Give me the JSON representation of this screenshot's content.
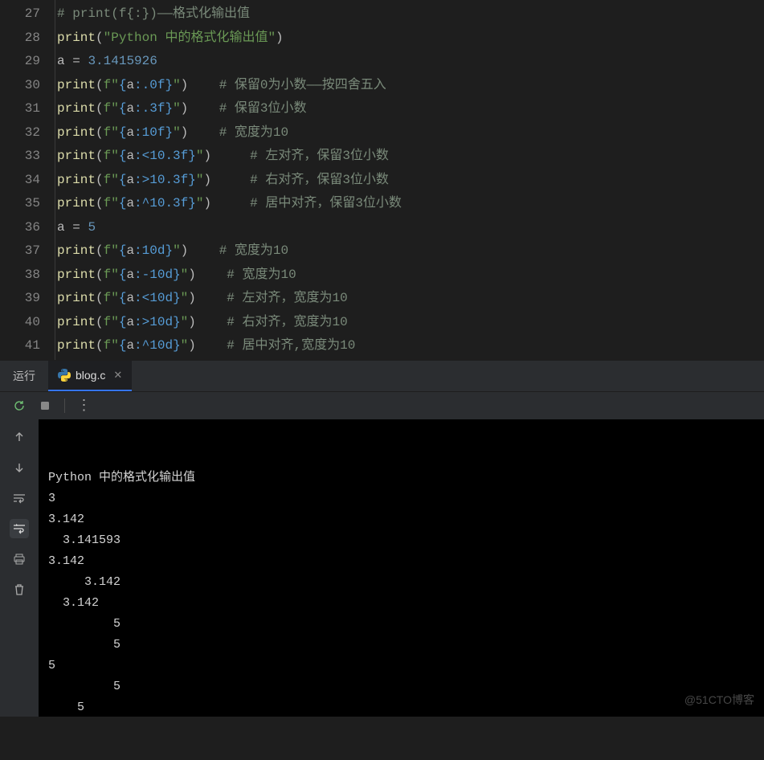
{
  "editor": {
    "startLine": 27,
    "lines": [
      {
        "n": 27,
        "type": "comment",
        "text": "# print(f{:})——格式化输出值"
      },
      {
        "n": 28,
        "type": "print_str",
        "str": "\"Python 中的格式化输出值\""
      },
      {
        "n": 29,
        "type": "assign",
        "var": "a",
        "val": "3.1415926"
      },
      {
        "n": 30,
        "type": "print_fmt",
        "pre": "f\"",
        "open": "{",
        "var": "a",
        "fmt": ":.0f",
        "close": "}",
        "post": "\"",
        "comment_gap": "    ",
        "comment": "# 保留0为小数——按四舍五入"
      },
      {
        "n": 31,
        "type": "print_fmt",
        "pre": "f\"",
        "open": "{",
        "var": "a",
        "fmt": ":.3f",
        "close": "}",
        "post": "\"",
        "comment_gap": "    ",
        "comment": "# 保留3位小数"
      },
      {
        "n": 32,
        "type": "print_fmt",
        "pre": "f\"",
        "open": "{",
        "var": "a",
        "fmt": ":10f",
        "close": "}",
        "post": "\"",
        "comment_gap": "    ",
        "comment": "# 宽度为10"
      },
      {
        "n": 33,
        "type": "print_fmt",
        "pre": "f\"",
        "open": "{",
        "var": "a",
        "fmt": ":<10.3f",
        "close": "}",
        "post": "\"",
        "comment_gap": "     ",
        "comment": "# 左对齐，保留3位小数"
      },
      {
        "n": 34,
        "type": "print_fmt",
        "pre": "f\"",
        "open": "{",
        "var": "a",
        "fmt": ":>10.3f",
        "close": "}",
        "post": "\"",
        "comment_gap": "     ",
        "comment": "# 右对齐，保留3位小数"
      },
      {
        "n": 35,
        "type": "print_fmt",
        "pre": "f\"",
        "open": "{",
        "var": "a",
        "fmt": ":^10.3f",
        "close": "}",
        "post": "\"",
        "comment_gap": "     ",
        "comment": "# 居中对齐，保留3位小数"
      },
      {
        "n": 36,
        "type": "assign",
        "var": "a",
        "val": "5"
      },
      {
        "n": 37,
        "type": "print_fmt",
        "pre": "f\"",
        "open": "{",
        "var": "a",
        "fmt": ":10d",
        "close": "}",
        "post": "\"",
        "comment_gap": "    ",
        "comment": "# 宽度为10"
      },
      {
        "n": 38,
        "type": "print_fmt",
        "pre": "f\"",
        "open": "{",
        "var": "a",
        "fmt": ":-10d",
        "close": "}",
        "post": "\"",
        "comment_gap": "    ",
        "comment": "# 宽度为10"
      },
      {
        "n": 39,
        "type": "print_fmt",
        "pre": "f\"",
        "open": "{",
        "var": "a",
        "fmt": ":<10d",
        "close": "}",
        "post": "\"",
        "comment_gap": "    ",
        "comment": "# 左对齐，宽度为10"
      },
      {
        "n": 40,
        "type": "print_fmt",
        "pre": "f\"",
        "open": "{",
        "var": "a",
        "fmt": ":>10d",
        "close": "}",
        "post": "\"",
        "comment_gap": "    ",
        "comment": "# 右对齐，宽度为10"
      },
      {
        "n": 41,
        "type": "print_fmt",
        "pre": "f\"",
        "open": "{",
        "var": "a",
        "fmt": ":^10d",
        "close": "}",
        "post": "\"",
        "comment_gap": "    ",
        "comment": "# 居中对齐,宽度为10"
      }
    ]
  },
  "panel": {
    "label": "运行",
    "tabName": "blog.c"
  },
  "console": {
    "lines": [
      "Python 中的格式化输出值",
      "3",
      "3.142",
      "  3.141593",
      "3.142",
      "     3.142",
      "  3.142",
      "         5",
      "         5",
      "5",
      "         5",
      "    5"
    ]
  },
  "watermark": "@51CTO博客"
}
